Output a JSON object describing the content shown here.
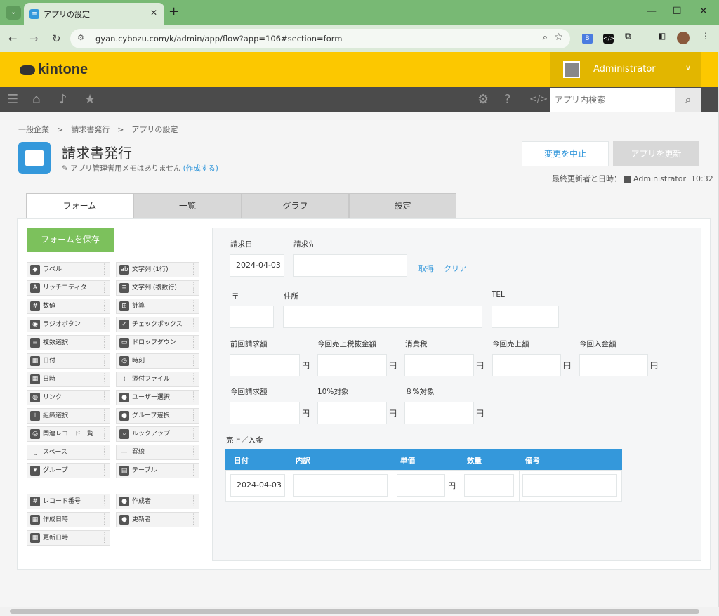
{
  "browser": {
    "tab_title": "アプリの設定",
    "url": "gyan.cybozu.com/k/admin/app/flow?app=106#section=form"
  },
  "header": {
    "logo": "kintone",
    "user_name": "Administrator",
    "search_placeholder": "アプリ内検索"
  },
  "breadcrumb": "一般企業　>　請求書発行　>　アプリの設定",
  "app": {
    "title": "請求書発行",
    "memo": "アプリ管理者用メモはありません",
    "memo_link": "(作成する)",
    "cancel_label": "変更を中止",
    "update_label": "アプリを更新",
    "last_updated": "最終更新者と日時：",
    "last_user": "Administrator",
    "last_time": "10:32"
  },
  "tabs": [
    "フォーム",
    "一覧",
    "グラフ",
    "設定"
  ],
  "palette": {
    "save_label": "フォームを保存",
    "left": [
      "ラベル",
      "リッチエディター",
      "数値",
      "ラジオボタン",
      "複数選択",
      "日付",
      "日時",
      "リンク",
      "組織選択",
      "関連レコード一覧",
      "スペース",
      "グループ"
    ],
    "right": [
      "文字列 (1行)",
      "文字列 (複数行)",
      "計算",
      "チェックボックス",
      "ドロップダウン",
      "時刻",
      "添付ファイル",
      "ユーザー選択",
      "グループ選択",
      "ルックアップ",
      "罫線",
      "テーブル"
    ],
    "system_left": [
      "レコード番号",
      "作成日時",
      "更新日時"
    ],
    "system_right": [
      "作成者",
      "更新者"
    ]
  },
  "form": {
    "invoice_date_label": "請求日",
    "invoice_date_value": "2024-04-03",
    "customer_label": "請求先",
    "fetch_label": "取得",
    "clear_label": "クリア",
    "postal_label": "〒",
    "address_label": "住所",
    "tel_label": "TEL",
    "prev_amount_label": "前回請求額",
    "sales_ex_tax_label": "今回売上税抜金額",
    "tax_label": "消費税",
    "sales_label": "今回売上額",
    "payment_label": "今回入金額",
    "current_invoice_label": "今回請求額",
    "ten_pct_label": "10%対象",
    "eight_pct_label": "８%対象",
    "unit_yen": "円",
    "subtable_label": "売上／入金",
    "subtable_headers": [
      "日付",
      "内訳",
      "単価",
      "数量",
      "備考"
    ],
    "subtable_date": "2024-04-03"
  }
}
